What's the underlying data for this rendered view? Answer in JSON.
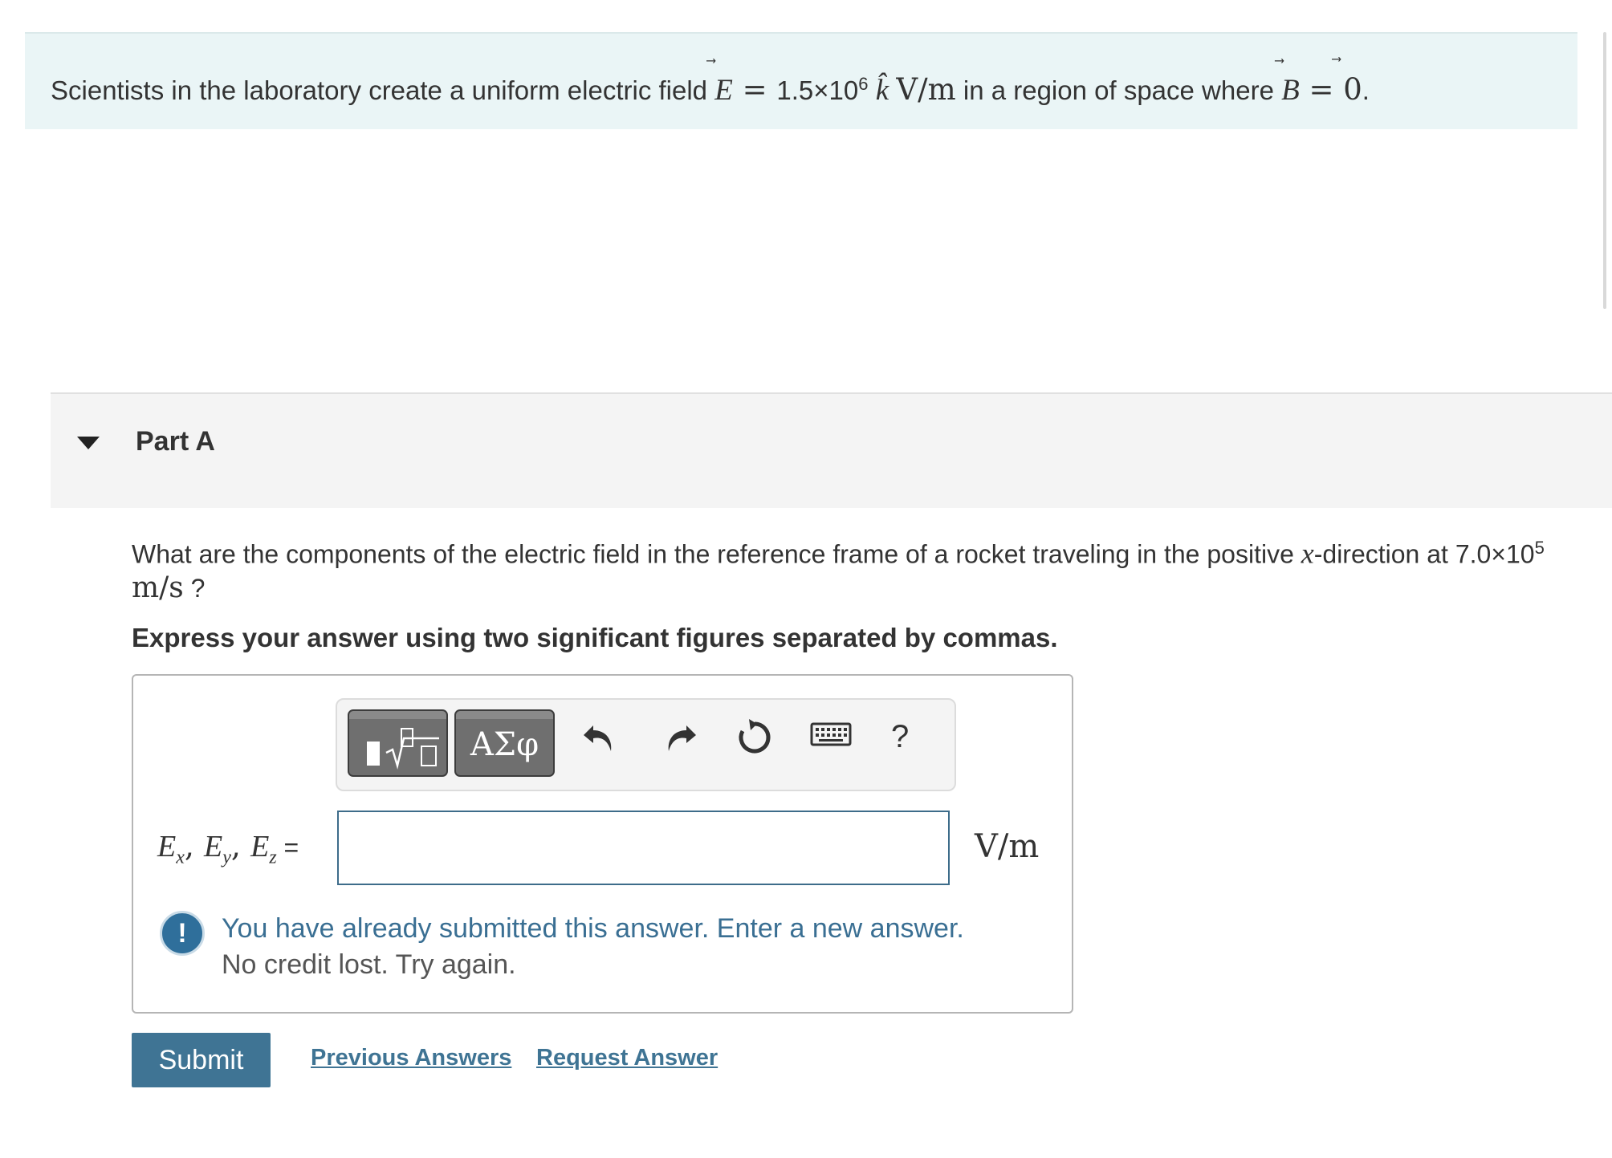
{
  "intro": {
    "text_before": "Scientists in the laboratory create a uniform electric field ",
    "e_symbol": "E",
    "equals": " = ",
    "field_value": "1.5×10",
    "field_exp": "6",
    "field_dir": " k̂ ",
    "field_unit": "V/m",
    "text_after": " in a region of space where ",
    "b_symbol": "B",
    "b_equals": " = ",
    "b_value": "0",
    "period": "."
  },
  "part": {
    "title": "Part A",
    "question_prefix": "What are the components of the electric field in the reference frame of a rocket traveling in the positive ",
    "question_var": "x",
    "question_mid": "-direction at 7.0×10",
    "question_exp": "5",
    "question_unit": "m/s",
    "question_suffix": " ?",
    "instruction": "Express your answer using two significant figures separated by commas."
  },
  "toolbar": {
    "templates_icon": "templates-sqrt-icon",
    "symbols_label": "ΑΣφ",
    "undo_icon": "undo-icon",
    "redo_icon": "redo-icon",
    "reset_icon": "reset-icon",
    "keyboard_icon": "keyboard-icon",
    "help_label": "?"
  },
  "answer": {
    "label_E": "E",
    "sub_x": "x",
    "sub_y": "y",
    "sub_z": "z",
    "comma": ", ",
    "equals": " =",
    "value": "",
    "unit": "V/m"
  },
  "feedback": {
    "icon": "!",
    "message": "You have already submitted this answer. Enter a new answer.",
    "detail": "No credit lost. Try again."
  },
  "actions": {
    "submit": "Submit",
    "previous_answers": "Previous Answers",
    "request_answer": "Request Answer"
  },
  "colors": {
    "accent": "#3f7494",
    "intro_bg": "#eaf5f6",
    "part_bg": "#f4f4f4"
  }
}
